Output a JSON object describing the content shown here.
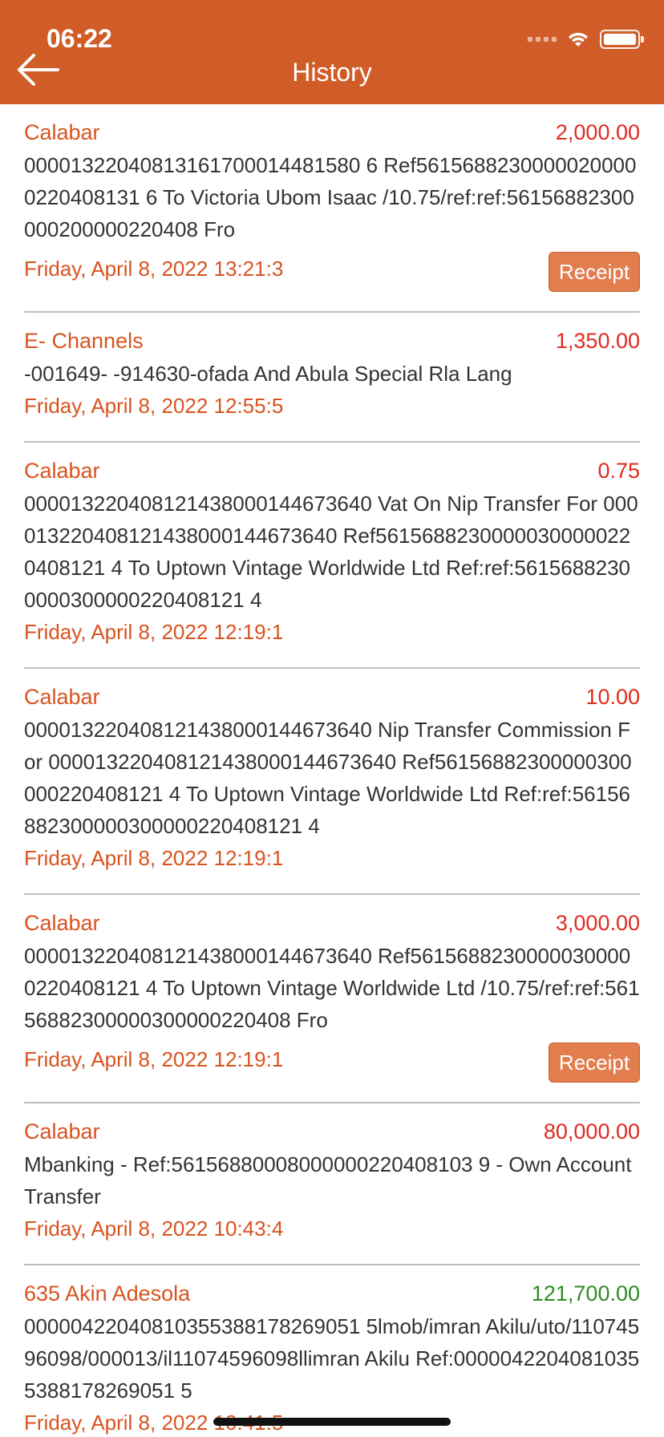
{
  "status_bar": {
    "time": "06:22"
  },
  "header": {
    "title": "History",
    "back_icon": "arrow-left-icon"
  },
  "theme": {
    "accent": "#D05C28",
    "debit": "#E02B1F",
    "credit": "#2E8B22",
    "receipt_button": "#E27D4E"
  },
  "transactions": [
    {
      "branch": "Calabar",
      "amount": "2,000.00",
      "type": "debit",
      "description": "00001322040813161700014481580 6 Ref56156882300000200000220408131 6 To Victoria Ubom Isaac /10.75/ref:ref:56156882300000200000220408 Fro",
      "date": "Friday, April 8, 2022 13:21:3",
      "receipt": "Receipt"
    },
    {
      "branch": "E- Channels",
      "amount": "1,350.00",
      "type": "debit",
      "description": "-001649- -914630-ofada And Abula Special Rla Lang",
      "date": "Friday, April 8, 2022 12:55:5",
      "receipt": ""
    },
    {
      "branch": "Calabar",
      "amount": "0.75",
      "type": "debit",
      "description": "000013220408121438000144673640 Vat On Nip Transfer For 000013220408121438000144673640 Ref56156882300000300000220408121 4 To Uptown Vintage Worldwide Ltd Ref:ref:56156882300000300000220408121 4",
      "date": "Friday, April 8, 2022 12:19:1",
      "receipt": ""
    },
    {
      "branch": "Calabar",
      "amount": "10.00",
      "type": "debit",
      "description": "000013220408121438000144673640 Nip Transfer Commission For 000013220408121438000144673640 Ref56156882300000300000220408121 4 To Uptown Vintage Worldwide Ltd Ref:ref:56156882300000300000220408121 4",
      "date": "Friday, April 8, 2022 12:19:1",
      "receipt": ""
    },
    {
      "branch": "Calabar",
      "amount": "3,000.00",
      "type": "debit",
      "description": "000013220408121438000144673640 Ref56156882300000300000220408121 4 To Uptown Vintage Worldwide Ltd /10.75/ref:ref:56156882300000300000220408 Fro",
      "date": "Friday, April 8, 2022 12:19:1",
      "receipt": "Receipt"
    },
    {
      "branch": "Calabar",
      "amount": "80,000.00",
      "type": "debit",
      "description": "Mbanking - Ref:56156880008000000220408103 9 - Own Account Transfer",
      "date": "Friday, April 8, 2022 10:43:4",
      "receipt": ""
    },
    {
      "branch": "635 Akin Adesola",
      "amount": "121,700.00",
      "type": "credit",
      "description": "00000422040810355388178269051 5lmob/imran Akilu/uto/11074596098/000013/il11074596098llimran Akilu Ref:00000422040810355388178269051 5",
      "date": "Friday, April 8, 2022 10:41:5",
      "receipt": ""
    }
  ]
}
